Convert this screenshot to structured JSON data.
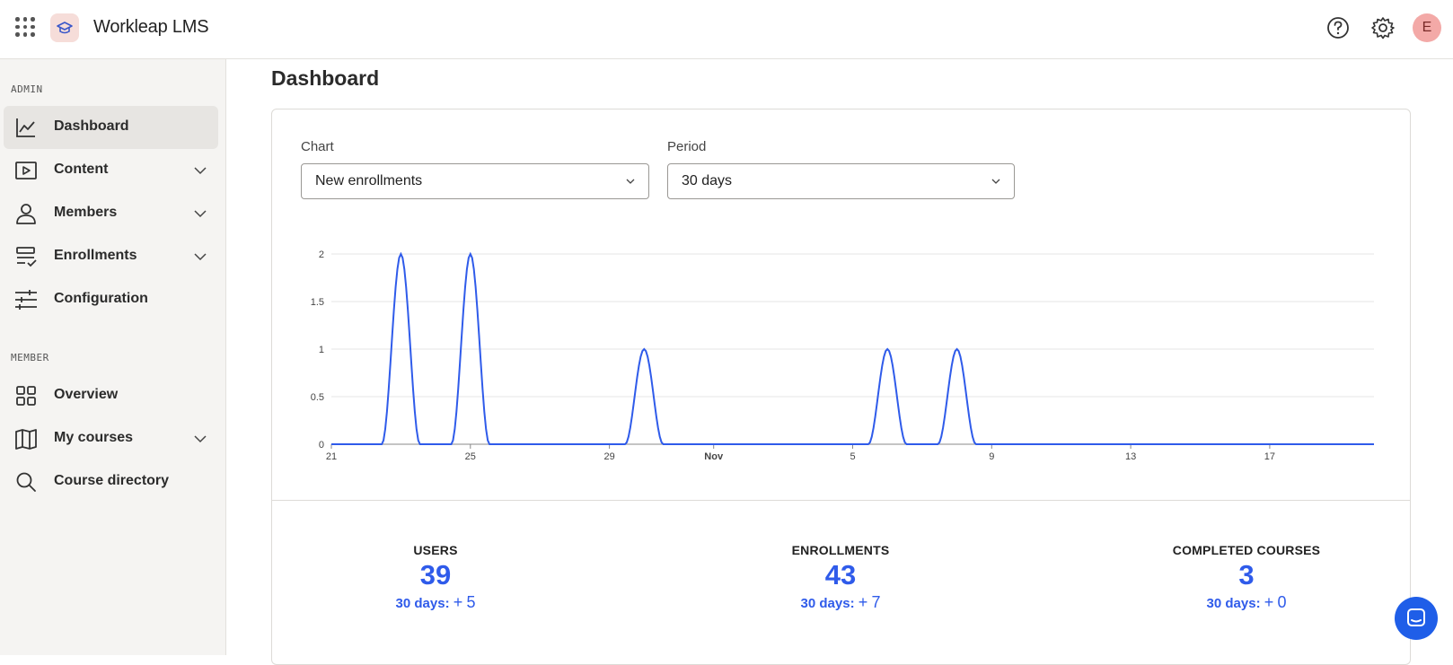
{
  "app": {
    "title": "Workleap LMS",
    "avatar_initial": "E"
  },
  "topbar": {
    "icons": [
      "apps-grid-icon",
      "help-icon",
      "gear-icon"
    ]
  },
  "sidebar": {
    "admin_label": "ADMIN",
    "member_label": "MEMBER",
    "admin_items": [
      {
        "label": "Dashboard",
        "icon": "line-chart-icon",
        "active": true,
        "expandable": false
      },
      {
        "label": "Content",
        "icon": "play-square-icon",
        "expandable": true
      },
      {
        "label": "Members",
        "icon": "person-icon",
        "expandable": true
      },
      {
        "label": "Enrollments",
        "icon": "list-check-icon",
        "expandable": true
      },
      {
        "label": "Configuration",
        "icon": "sliders-icon",
        "expandable": false
      }
    ],
    "member_items": [
      {
        "label": "Overview",
        "icon": "grid-icon",
        "expandable": false
      },
      {
        "label": "My courses",
        "icon": "book-icon",
        "expandable": true
      },
      {
        "label": "Course directory",
        "icon": "search-icon",
        "expandable": false
      }
    ]
  },
  "main": {
    "page_title": "Dashboard",
    "chart_select": {
      "label": "Chart",
      "value": "New enrollments"
    },
    "period_select": {
      "label": "Period",
      "value": "30 days"
    },
    "stats": [
      {
        "label": "USERS",
        "value": "39",
        "delta_label": "30 days:",
        "delta_sign": "+",
        "delta_value": "5"
      },
      {
        "label": "ENROLLMENTS",
        "value": "43",
        "delta_label": "30 days:",
        "delta_sign": "+",
        "delta_value": "7"
      },
      {
        "label": "COMPLETED COURSES",
        "value": "3",
        "delta_label": "30 days:",
        "delta_sign": "+",
        "delta_value": "0"
      }
    ]
  },
  "chart_data": {
    "type": "line",
    "x_days": [
      "2023-10-21",
      "2023-10-22",
      "2023-10-23",
      "2023-10-24",
      "2023-10-25",
      "2023-10-26",
      "2023-10-27",
      "2023-10-28",
      "2023-10-29",
      "2023-10-30",
      "2023-10-31",
      "2023-11-01",
      "2023-11-02",
      "2023-11-03",
      "2023-11-04",
      "2023-11-05",
      "2023-11-06",
      "2023-11-07",
      "2023-11-08",
      "2023-11-09",
      "2023-11-10",
      "2023-11-11",
      "2023-11-12",
      "2023-11-13",
      "2023-11-14",
      "2023-11-15",
      "2023-11-16",
      "2023-11-17",
      "2023-11-18",
      "2023-11-19",
      "2023-11-20"
    ],
    "series": [
      {
        "values": [
          0,
          0,
          2,
          0,
          2,
          0,
          0,
          0,
          0,
          1,
          0,
          0,
          0,
          0,
          0,
          0,
          1,
          0,
          1,
          0,
          0,
          0,
          0,
          0,
          0,
          0,
          0,
          0,
          0,
          0,
          0
        ]
      }
    ],
    "x_tick_labels": [
      "21",
      "25",
      "29",
      "Nov",
      "5",
      "9",
      "13",
      "17"
    ],
    "y_tick_labels": [
      "0",
      "0.5",
      "1",
      "1.5",
      "2"
    ],
    "ylim": [
      0,
      2
    ],
    "grid": true,
    "color": "#2f5bea"
  }
}
